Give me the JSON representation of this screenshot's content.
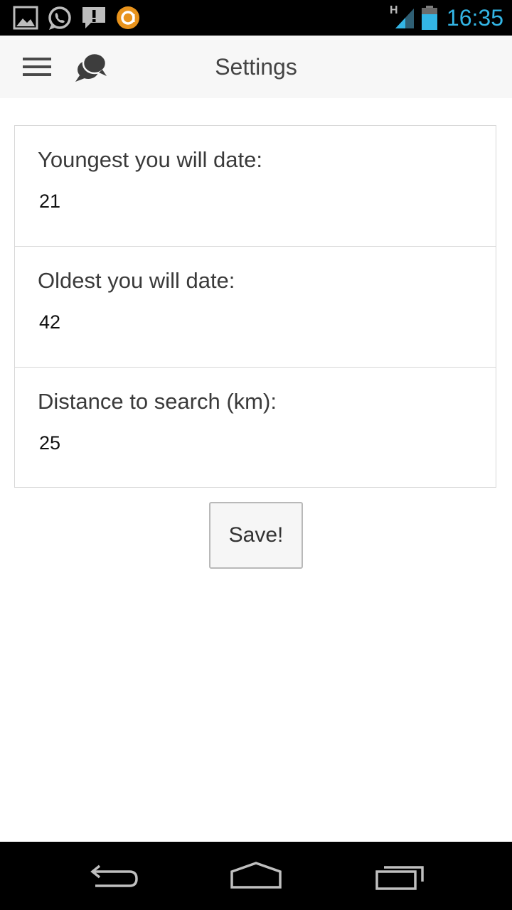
{
  "status_bar": {
    "time": "16:35",
    "network_label": "H",
    "icons": [
      "picture-icon",
      "whatsapp-icon",
      "alert-icon",
      "app-badge-icon",
      "signal-icon",
      "battery-icon"
    ]
  },
  "action_bar": {
    "title": "Settings",
    "menu_icon": "hamburger-icon",
    "app_icon": "chat-bubbles-icon"
  },
  "settings": {
    "fields": [
      {
        "label": "Youngest you will date:",
        "value": "21"
      },
      {
        "label": "Oldest you will date:",
        "value": "42"
      },
      {
        "label": "Distance to search (km):",
        "value": "25"
      }
    ],
    "save_label": "Save!"
  },
  "nav_bar": {
    "icons": [
      "back-icon",
      "home-icon",
      "recents-icon"
    ]
  },
  "colors": {
    "status_time": "#33b5e5",
    "action_bar_bg": "#f7f7f7",
    "text": "#3a3a3a",
    "border": "#d8d8d8",
    "badge_orange": "#e8931c"
  }
}
